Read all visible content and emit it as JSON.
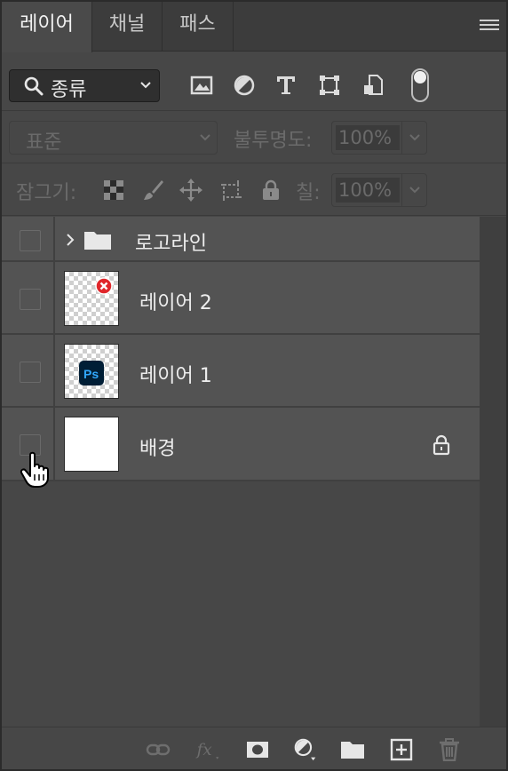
{
  "tabs": [
    {
      "label": "레이어",
      "active": true
    },
    {
      "label": "채널",
      "active": false
    },
    {
      "label": "패스",
      "active": false
    }
  ],
  "filter": {
    "kind_label": "종류",
    "icons": [
      "image-filter-icon",
      "adjustment-filter-icon",
      "type-filter-icon",
      "shape-filter-icon",
      "smart-object-filter-icon"
    ]
  },
  "blend": {
    "mode": "표준",
    "opacity_label": "불투명도:",
    "opacity_value": "100%"
  },
  "lock": {
    "label": "잠그기:",
    "fill_label": "칠:",
    "fill_value": "100%"
  },
  "layers": [
    {
      "name": "로고라인",
      "type": "group"
    },
    {
      "name": "레이어 2",
      "type": "pixel"
    },
    {
      "name": "레이어 1",
      "type": "pixel"
    },
    {
      "name": "배경",
      "type": "background",
      "locked": true
    }
  ],
  "colors": {
    "panel_bg": "#474747",
    "row_bg": "#535353",
    "error_badge": "#e0262b",
    "ps_blue": "#31a8ff",
    "ps_dark": "#001e36"
  }
}
